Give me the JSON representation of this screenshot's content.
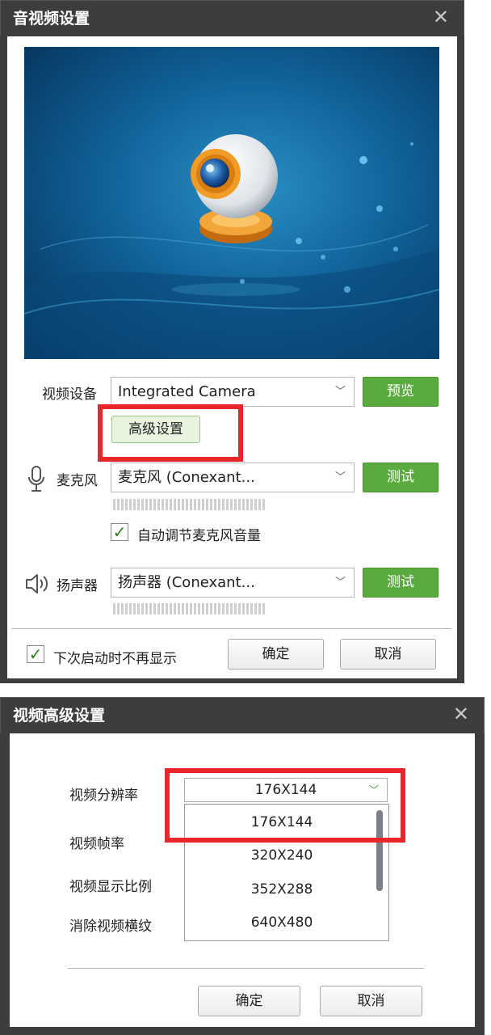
{
  "av_dialog": {
    "title": "音视频设置",
    "close": "✕",
    "video_device": {
      "label": "视频设备",
      "value": "Integrated Camera",
      "preview_button": "预览"
    },
    "advanced_button": "高级设置",
    "microphone": {
      "label": "麦克风",
      "value": "麦克风 (Conexant...",
      "test_button": "测试"
    },
    "auto_adjust_mic": {
      "label": "自动调节麦克风音量",
      "checked": true
    },
    "speaker": {
      "label": "扬声器",
      "value": "扬声器 (Conexant...",
      "test_button": "测试"
    },
    "dont_show": {
      "label": "下次启动时不再显示",
      "checked": true
    },
    "ok_button": "确定",
    "cancel_button": "取消"
  },
  "advanced_dialog": {
    "title": "视频高级设置",
    "close": "✕",
    "labels": {
      "resolution": "视频分辨率",
      "frame_rate": "视频帧率",
      "aspect_ratio": "视频显示比例",
      "anti_flicker": "消除视频横纹"
    },
    "resolution_selected": "176X144",
    "resolution_options": [
      "176X144",
      "320X240",
      "352X288",
      "640X480"
    ],
    "ok_button": "确定",
    "cancel_button": "取消"
  },
  "colors": {
    "titlebar": "#3d3d3d",
    "green_button": "#5aab3e",
    "highlight_red": "#e8262c"
  }
}
